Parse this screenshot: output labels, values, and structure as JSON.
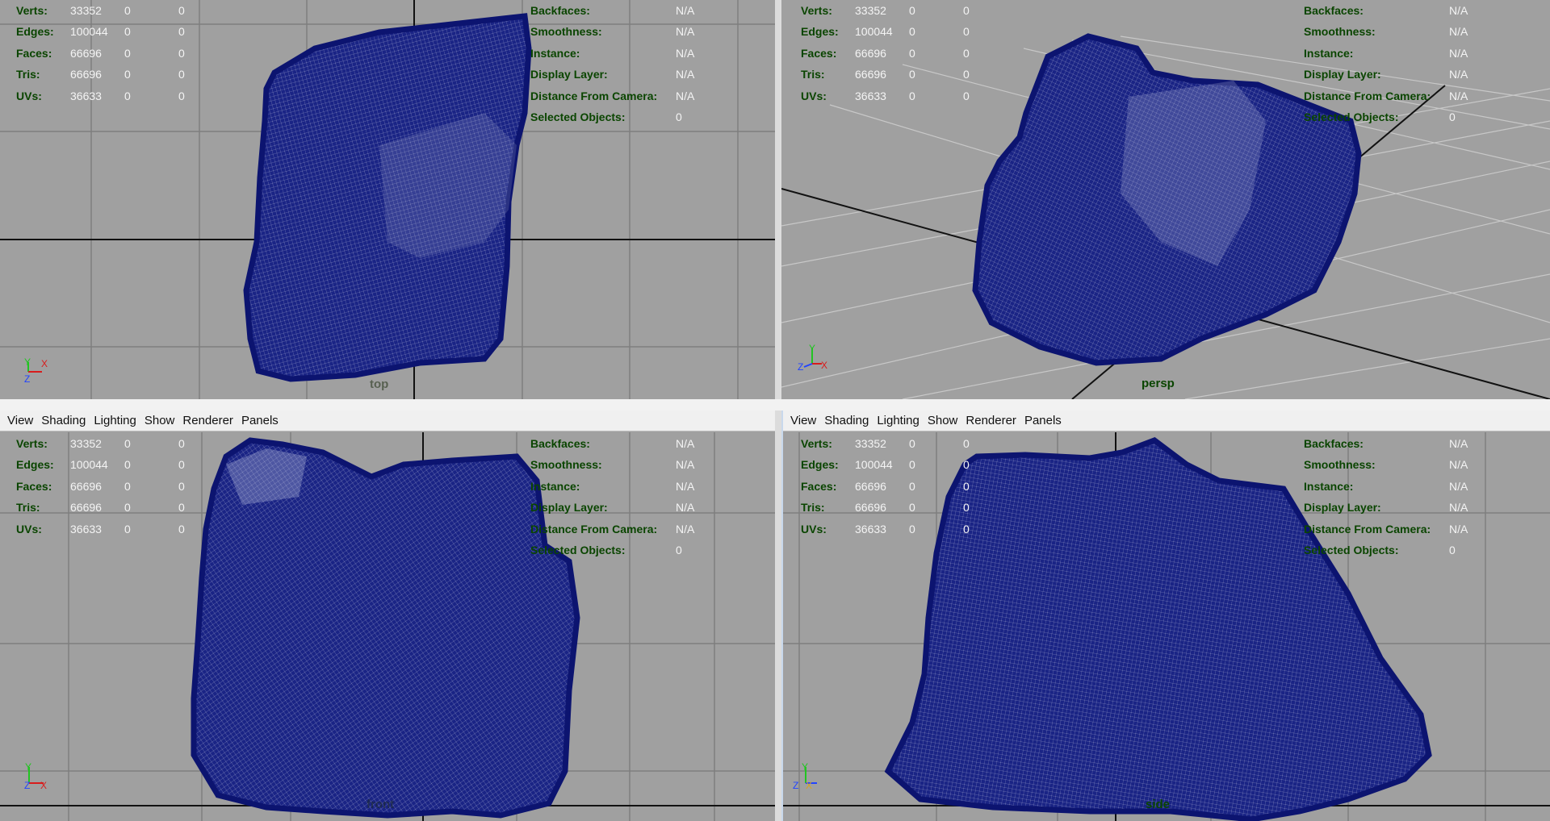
{
  "menu": [
    "View",
    "Shading",
    "Lighting",
    "Show",
    "Renderer",
    "Panels"
  ],
  "hud_left": {
    "rows": [
      {
        "label": "Verts:",
        "values": [
          "33352",
          "0",
          "0"
        ]
      },
      {
        "label": "Edges:",
        "values": [
          "100044",
          "0",
          "0"
        ]
      },
      {
        "label": "Faces:",
        "values": [
          "66696",
          "0",
          "0"
        ]
      },
      {
        "label": "Tris:",
        "values": [
          "66696",
          "0",
          "0"
        ]
      },
      {
        "label": "UVs:",
        "values": [
          "36633",
          "0",
          "0"
        ]
      }
    ]
  },
  "hud_right": {
    "rows": [
      {
        "label": "Backfaces:",
        "value": "N/A"
      },
      {
        "label": "Smoothness:",
        "value": "N/A"
      },
      {
        "label": "Instance:",
        "value": "N/A"
      },
      {
        "label": "Display Layer:",
        "value": "N/A"
      },
      {
        "label": "Distance From Camera:",
        "value": "N/A"
      },
      {
        "label": "Selected Objects:",
        "value": "0"
      }
    ]
  },
  "viewports": {
    "top": {
      "camera": "top",
      "axes": [
        "Y",
        "X",
        "Z"
      ]
    },
    "persp": {
      "camera": "persp",
      "axes": [
        "Y",
        "Z",
        "X"
      ]
    },
    "front": {
      "camera": "front",
      "axes": [
        "Y",
        "Z",
        "X"
      ]
    },
    "side": {
      "camera": "side",
      "axes": [
        "Y",
        "Z",
        "X"
      ]
    }
  },
  "colors": {
    "viewport_bg": "#a0a0a0",
    "mesh": "#0c1470",
    "hud_label": "#0a4500",
    "hud_value": "#f4f4f4",
    "grid": "#7f7f7f",
    "axis_x": "#d81c1c",
    "axis_y": "#22c422",
    "axis_z": "#2244ff"
  }
}
